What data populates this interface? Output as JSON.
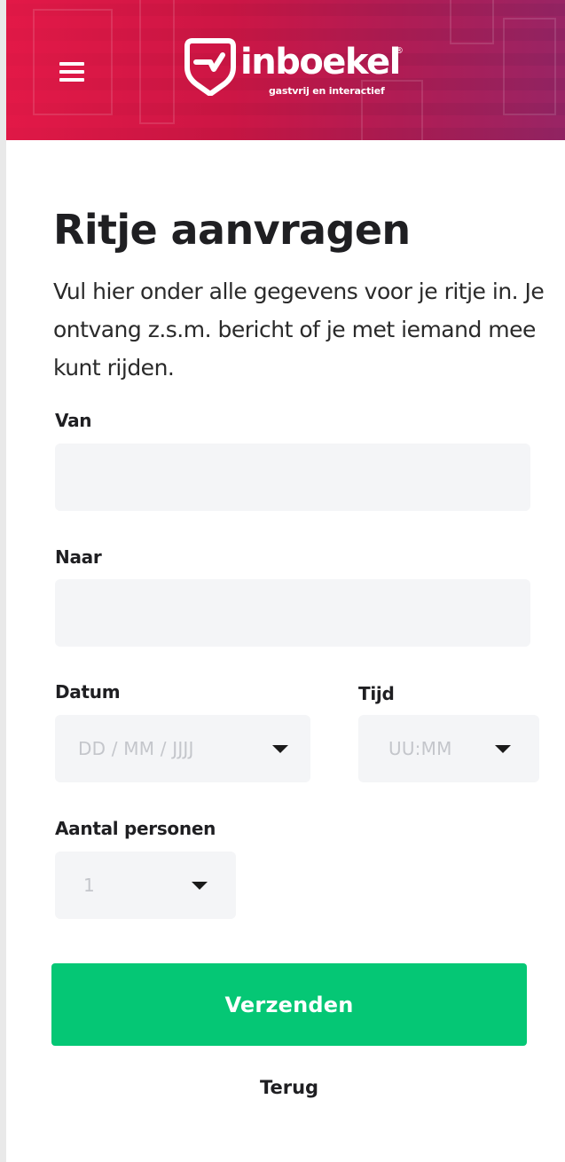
{
  "header": {
    "logo_text": "inboekel",
    "logo_registered": "®",
    "logo_tagline": "gastvrij en interactief",
    "menu_icon": "hamburger-menu-icon",
    "accent_color": "#e8194a"
  },
  "page": {
    "title": "Ritje aanvragen",
    "intro": "Vul hier onder alle gegevens voor je ritje in. Je ontvang z.s.m. bericht of je met iemand mee kunt rijden."
  },
  "form": {
    "from_label": "Van",
    "from_value": "",
    "to_label": "Naar",
    "to_value": "",
    "date_label": "Datum",
    "date_placeholder": "DD / MM / JJJJ",
    "time_label": "Tijd",
    "time_placeholder": "UU:MM",
    "persons_label": "Aantal personen",
    "persons_value": "1",
    "submit_label": "Verzenden",
    "back_label": "Terug",
    "button_color": "#05c775",
    "field_bg": "#f4f5f7"
  }
}
